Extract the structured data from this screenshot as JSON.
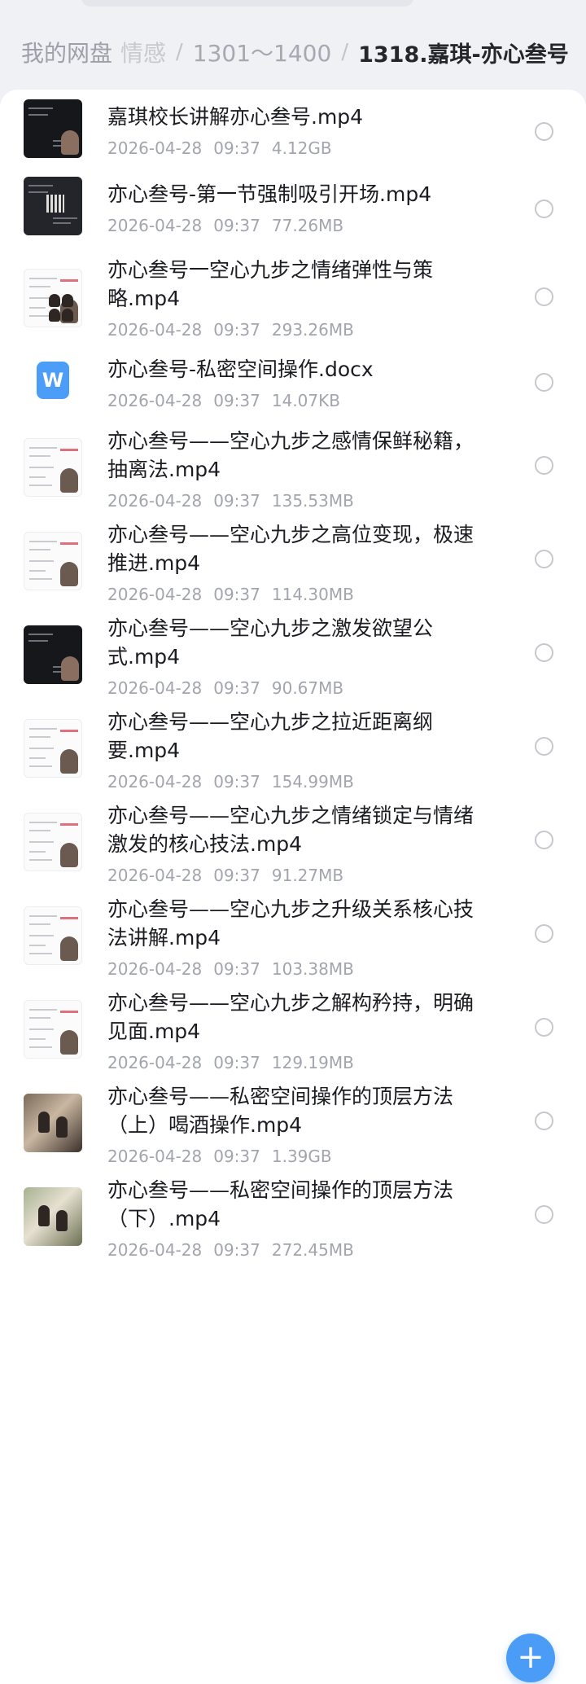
{
  "breadcrumb": {
    "home": "我的网盘",
    "folder1": "情感",
    "folder2": "1301～1400",
    "current": "1318.嘉琪-亦心叁号",
    "separator": "/"
  },
  "files": [
    {
      "name_lines": [
        "嘉琪校长讲解亦心叁号.mp4"
      ],
      "date": "2026-04-28",
      "time": "09:37",
      "size": "4.12GB",
      "thumb": "dark"
    },
    {
      "name_lines": [
        "亦心叁号-第一节强制吸引开场.mp4"
      ],
      "date": "2026-04-28",
      "time": "09:37",
      "size": "77.26MB",
      "thumb": "dark2"
    },
    {
      "name_lines": [
        "亦心叁号一空心九步之情绪弹性与策",
        "略.mp4"
      ],
      "date": "2026-04-28",
      "time": "09:37",
      "size": "293.26MB",
      "thumb": "light-people"
    },
    {
      "name_lines": [
        "亦心叁号-私密空间操作.docx"
      ],
      "date": "2026-04-28",
      "time": "09:37",
      "size": "14.07KB",
      "thumb": "word-doc",
      "icon_letter": "W"
    },
    {
      "name_lines": [
        "亦心叁号——空心九步之感情保鲜秘籍，",
        "抽离法.mp4"
      ],
      "date": "2026-04-28",
      "time": "09:37",
      "size": "135.53MB",
      "thumb": "light"
    },
    {
      "name_lines": [
        "亦心叁号——空心九步之高位变现，极速",
        "推进.mp4"
      ],
      "date": "2026-04-28",
      "time": "09:37",
      "size": "114.30MB",
      "thumb": "light"
    },
    {
      "name_lines": [
        "亦心叁号——空心九步之激发欲望公",
        "式.mp4"
      ],
      "date": "2026-04-28",
      "time": "09:37",
      "size": "90.67MB",
      "thumb": "dark"
    },
    {
      "name_lines": [
        "亦心叁号——空心九步之拉近距离纲",
        "要.mp4"
      ],
      "date": "2026-04-28",
      "time": "09:37",
      "size": "154.99MB",
      "thumb": "light"
    },
    {
      "name_lines": [
        "亦心叁号——空心九步之情绪锁定与情绪",
        "激发的核心技法.mp4"
      ],
      "date": "2026-04-28",
      "time": "09:37",
      "size": "91.27MB",
      "thumb": "light"
    },
    {
      "name_lines": [
        "亦心叁号——空心九步之升级关系核心技",
        "法讲解.mp4"
      ],
      "date": "2026-04-28",
      "time": "09:37",
      "size": "103.38MB",
      "thumb": "light"
    },
    {
      "name_lines": [
        "亦心叁号——空心九步之解构矜持，明确",
        "见面.mp4"
      ],
      "date": "2026-04-28",
      "time": "09:37",
      "size": "129.19MB",
      "thumb": "light"
    },
    {
      "name_lines": [
        "亦心叁号——私密空间操作的顶层方法",
        "（上）喝酒操作.mp4"
      ],
      "date": "2026-04-28",
      "time": "09:37",
      "size": "1.39GB",
      "thumb": "photo-warm"
    },
    {
      "name_lines": [
        "亦心叁号——私密空间操作的顶层方法",
        "（下）.mp4"
      ],
      "date": "2026-04-28",
      "time": "09:37",
      "size": "272.45MB",
      "thumb": "photo-green"
    }
  ],
  "fab": {
    "label": "+"
  },
  "colors": {
    "accent": "#4a9cf6",
    "text": "#1b1c21",
    "meta": "#a2a5ad"
  }
}
